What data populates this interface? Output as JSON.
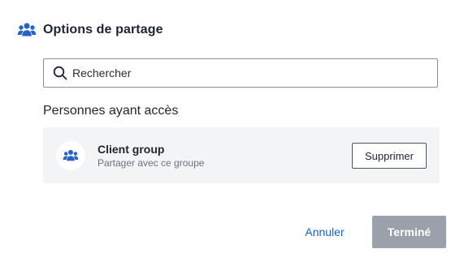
{
  "dialog": {
    "title": "Options de partage",
    "title_icon": "group-icon"
  },
  "search": {
    "placeholder": "Rechercher",
    "value": "",
    "icon": "search-icon"
  },
  "access": {
    "heading": "Personnes ayant accès",
    "items": [
      {
        "name": "Client group",
        "description": "Partager avec ce groupe",
        "avatar_icon": "group-icon",
        "remove_label": "Supprimer"
      }
    ]
  },
  "footer": {
    "cancel_label": "Annuler",
    "done_label": "Terminé",
    "done_disabled": true
  },
  "colors": {
    "accent": "#1565c0",
    "group_icon": "#2563c9",
    "row_background": "#f3f4f6",
    "disabled_button": "#9aa1ab"
  }
}
